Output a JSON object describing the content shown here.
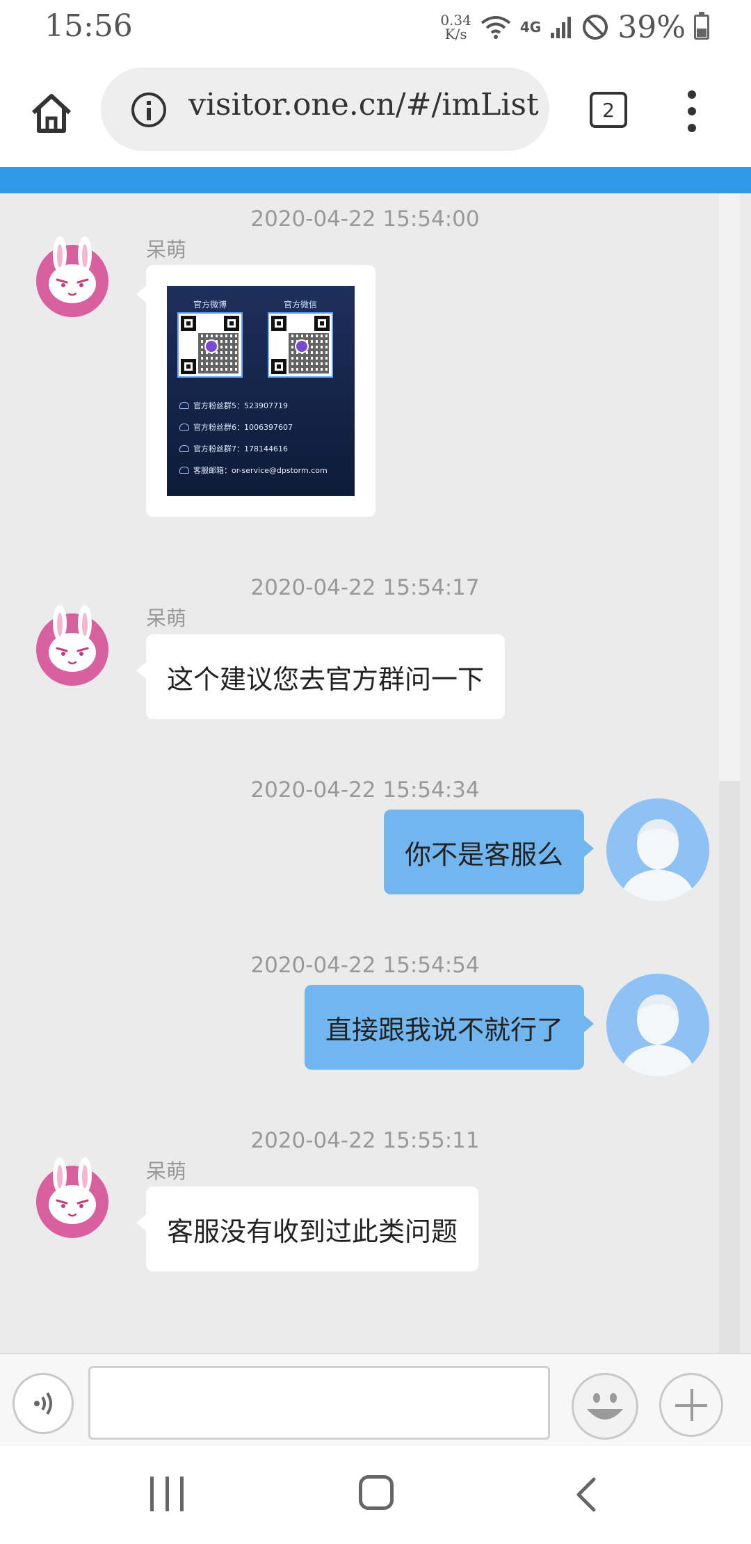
{
  "status_bar": {
    "time": "15:56",
    "net_speed_value": "0.34",
    "net_speed_unit": "K/s",
    "network_type": "4G",
    "battery": "39%",
    "icons": [
      "wifi-icon",
      "signal-icon",
      "do-not-disturb-icon",
      "battery-icon"
    ]
  },
  "browser": {
    "url": "visitor.one.cn/#/imList",
    "tab_count": "2",
    "icons": [
      "home-icon",
      "info-icon",
      "tabs-icon",
      "more-menu-icon"
    ]
  },
  "chat": {
    "messages": [
      {
        "timestamp": "2020-04-22 15:54:00",
        "sender": "呆萌",
        "side": "left",
        "type": "image",
        "image": {
          "qr_labels": [
            "官方微博",
            "官方微信"
          ],
          "lines": [
            "官方粉丝群5：523907719",
            "官方粉丝群6：1006397607",
            "官方粉丝群7：178144616",
            "客服邮箱：or-service@dpstorm.com"
          ]
        }
      },
      {
        "timestamp": "2020-04-22 15:54:17",
        "sender": "呆萌",
        "side": "left",
        "text": "这个建议您去官方群问一下"
      },
      {
        "timestamp": "2020-04-22 15:54:34",
        "side": "right",
        "text": "你不是客服么"
      },
      {
        "timestamp": "2020-04-22 15:54:54",
        "side": "right",
        "text": "直接跟我说不就行了"
      },
      {
        "timestamp": "2020-04-22 15:55:11",
        "sender": "呆萌",
        "side": "left",
        "text": "客服没有收到过此类问题"
      }
    ]
  },
  "input_bar": {
    "message_value": "",
    "icons": [
      "voice-icon",
      "emoji-icon",
      "plus-icon"
    ]
  },
  "nav_bar": {
    "icons": [
      "recent-apps-icon",
      "home-nav-icon",
      "back-icon"
    ]
  },
  "colors": {
    "accent_bar": "#2f9ae8",
    "chat_bg": "#ebebeb",
    "own_bubble": "#72b6ef",
    "agent_avatar": "#d9609f",
    "user_avatar": "#8ec1f4"
  }
}
